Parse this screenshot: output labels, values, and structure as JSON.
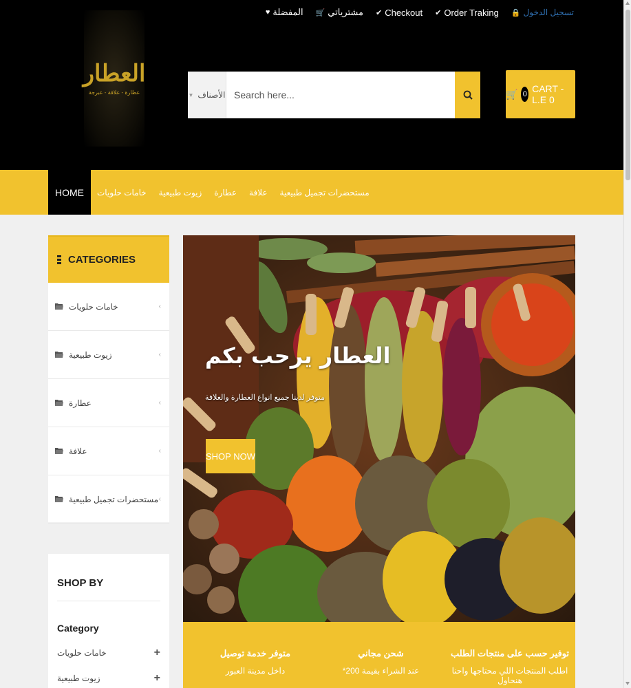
{
  "topbar": {
    "links": [
      {
        "label": "تسجيل الدخول",
        "icon": "lock-icon"
      },
      {
        "label": "Order Traking",
        "icon": "check-icon"
      },
      {
        "label": "Checkout",
        "icon": "check-icon"
      },
      {
        "label": "مشترياتي",
        "icon": "cart-icon"
      },
      {
        "label": "المفضلة",
        "icon": "heart-icon"
      }
    ]
  },
  "logo": {
    "main": "العطار",
    "sub": "عطارة - علافة - عبرجة"
  },
  "search": {
    "category_label": "الأصناف",
    "placeholder": "Search here...",
    "button_icon": "search-icon"
  },
  "cart": {
    "count": "0",
    "label": "CART - L.E 0",
    "icon": "cart-icon"
  },
  "nav": {
    "items": [
      "HOME",
      "خامات حلويات",
      "زيوت طبيعية",
      "عطارة",
      "علافة",
      "مستحضرات تجميل طبيعية"
    ],
    "active": "HOME"
  },
  "categories": {
    "title": "CATEGORIES",
    "items": [
      "خامات حلويات",
      "زيوت طبيعية",
      "عطارة",
      "علافة",
      "مستحضرات تجميل طبيعية"
    ]
  },
  "shopby": {
    "title": "SHOP BY",
    "subtitle": "Category",
    "items": [
      "خامات حلويات",
      "زيوت طبيعية"
    ]
  },
  "banner": {
    "title": "العطار يرحب بكم",
    "subtitle": "متوفر لدينا جميع انواع العطارة والعلافة",
    "button": "SHOP NOW"
  },
  "features": [
    {
      "title": "متوفر خدمة توصيل",
      "text": "داخل مدينة العبور"
    },
    {
      "title": "شحن مجاني",
      "text": "*عند الشراء بقيمة 200"
    },
    {
      "title": "توفير حسب على منتجات الطلب",
      "text": "اطلب المنتجات اللي محتاجها واحنا هنحاول"
    }
  ],
  "colors": {
    "accent": "#f1c22e",
    "header": "#000000",
    "link": "#2f6fb0"
  }
}
